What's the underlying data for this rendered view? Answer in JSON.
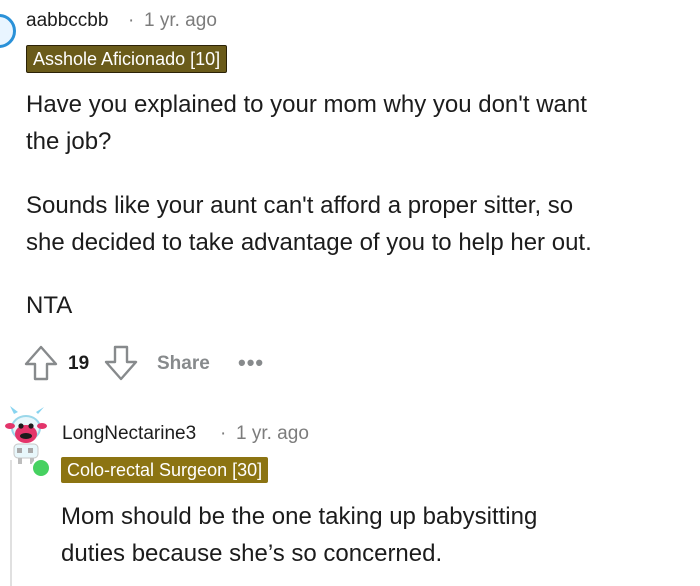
{
  "comments": [
    {
      "username": "aabbccbb",
      "separator": "·",
      "time": "1 yr. ago",
      "flair": "Asshole Aficionado [10]",
      "paragraphs": [
        "Have you explained to your mom why you don't want",
        "the job?",
        "Sounds like your aunt can't afford a proper sitter, so",
        "she decided to take advantage of you to help her out.",
        "NTA"
      ],
      "votes": "19",
      "share_label": "Share",
      "more_label": "•••"
    },
    {
      "username": "LongNectarine3",
      "separator": "·",
      "time": "1 yr. ago",
      "flair": "Colo-rectal Surgeon [30]",
      "paragraphs": [
        "Mom should be the one taking up babysitting",
        "duties because she’s so concerned."
      ]
    }
  ],
  "icons": {
    "upvote": "upvote-arrow-icon",
    "downvote": "downvote-arrow-icon"
  },
  "colors": {
    "flair1_bg": "#6a5b1a",
    "flair2_bg": "#8c7412",
    "online": "#46d160"
  }
}
